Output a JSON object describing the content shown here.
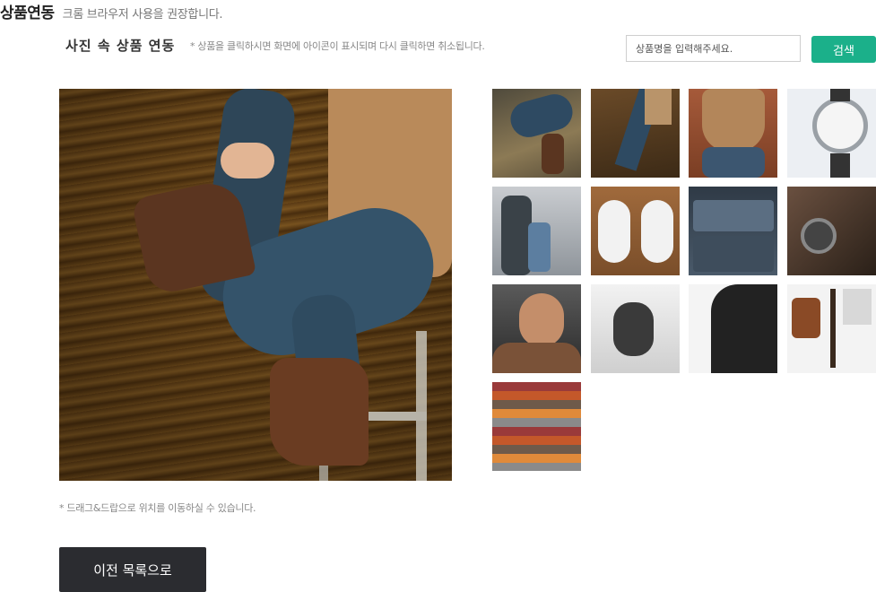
{
  "header": {
    "title": "상품연동",
    "note": "크롬 브라우저 사용을 권장합니다."
  },
  "section": {
    "title": "사진 속 상품 연동",
    "hint": "* 상품을 클릭하시면 화면에 아이콘이 표시되며 다시 클릭하면 취소됩니다."
  },
  "search": {
    "placeholder": "상품명을 입력해주세요.",
    "button_label": "검색"
  },
  "drag_hint": "* 드래그&드랍으로 위치를 이동하실 수 있습니다.",
  "back_button_label": "이전 목록으로",
  "colors": {
    "accent": "#1bb08a",
    "dark_button": "#2b2c30"
  }
}
